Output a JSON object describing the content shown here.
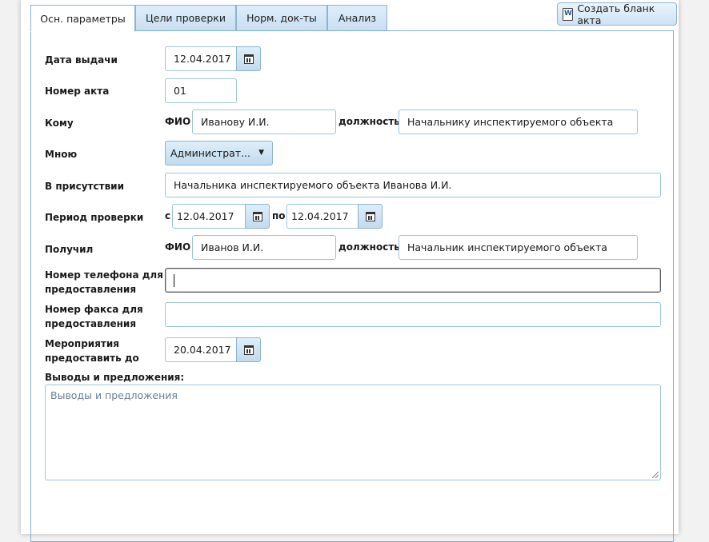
{
  "tabs": [
    {
      "label": "Осн. параметры",
      "active": true
    },
    {
      "label": "Цели проверки",
      "active": false
    },
    {
      "label": "Норм. док-ты",
      "active": false
    },
    {
      "label": "Анализ",
      "active": false
    }
  ],
  "toolbar": {
    "create_label": "Создать бланк акта",
    "create_icon": "word-document-icon"
  },
  "form": {
    "issue_date": {
      "label": "Дата выдачи",
      "value": "12.04.2017"
    },
    "act_number": {
      "label": "Номер акта",
      "value": "01"
    },
    "to_whom": {
      "label": "Кому",
      "fio_label": "ФИО",
      "fio_value": "Иванову И.И.",
      "position_label": "должность",
      "position_value": "Начальнику инспектируемого объекта"
    },
    "by_me": {
      "label": "Мною",
      "value": "Администрат..."
    },
    "in_presence": {
      "label": "В присутствии",
      "value": "Начальника инспектируемого объекта Иванова И.И."
    },
    "period": {
      "label": "Период проверки",
      "from_label": "с",
      "from_value": "12.04.2017",
      "to_label": "по",
      "to_value": "12.04.2017"
    },
    "received": {
      "label": "Получил",
      "fio_label": "ФИО",
      "fio_value": "Иванов И.И.",
      "position_label": "должность",
      "position_value": "Начальник инспектируемого объекта"
    },
    "phone": {
      "label_line1": "Номер телефона для",
      "label_line2": "предоставления",
      "value": ""
    },
    "fax": {
      "label_line1": "Номер факса для",
      "label_line2": "предоставления",
      "value": ""
    },
    "measures": {
      "label_line1": "Мероприятия",
      "label_line2": "предоставить до",
      "value": "20.04.2017"
    },
    "conclusions": {
      "label": "Выводы и предложения:",
      "placeholder": "Выводы и предложения"
    }
  },
  "colors": {
    "border": "#7fb2cf",
    "tab_bg": "#c7def0",
    "text": "#1a1a1a"
  }
}
